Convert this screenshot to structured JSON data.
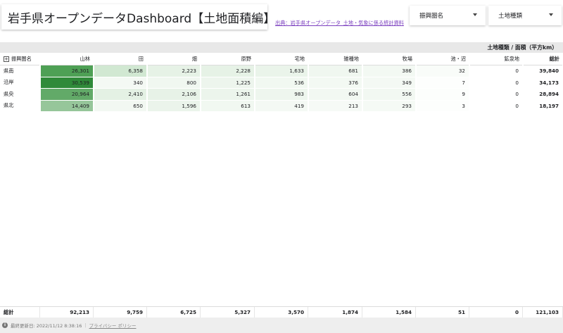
{
  "header": {
    "title": "岩手県オープンデータDashboard【土地面積編】",
    "source_link": "出典：岩手県オープンデータ_土地・気象に係る統計資料",
    "filters": [
      {
        "label": "振興圏名"
      },
      {
        "label": "土地種類"
      }
    ]
  },
  "table": {
    "pivot_header": "土地種類 / 面積（平方km）",
    "row_header": "振興圏名",
    "columns": [
      "山林",
      "田",
      "畑",
      "原野",
      "宅地",
      "雑種地",
      "牧場",
      "池・沼",
      "鉱泉地"
    ],
    "total_label": "総計",
    "rows": [
      {
        "name": "県南",
        "values": [
          "26,301",
          "6,358",
          "2,223",
          "2,228",
          "1,633",
          "681",
          "386",
          "32",
          "0"
        ],
        "total": "39,840"
      },
      {
        "name": "沿岸",
        "values": [
          "30,539",
          "340",
          "800",
          "1,225",
          "536",
          "376",
          "349",
          "7",
          "0"
        ],
        "total": "34,173"
      },
      {
        "name": "県央",
        "values": [
          "20,964",
          "2,410",
          "2,106",
          "1,261",
          "983",
          "604",
          "556",
          "9",
          "0"
        ],
        "total": "28,894"
      },
      {
        "name": "県北",
        "values": [
          "14,409",
          "650",
          "1,596",
          "613",
          "419",
          "213",
          "293",
          "3",
          "0"
        ],
        "total": "18,197"
      }
    ],
    "totals": {
      "label": "総計",
      "values": [
        "92,213",
        "9,759",
        "6,725",
        "5,327",
        "3,570",
        "1,874",
        "1,584",
        "51",
        "0"
      ],
      "grand_total": "121,103"
    },
    "heat_colors": {
      "row0": [
        "#4ea055",
        "#d1e8d2",
        "#e6f2e6",
        "#e6f2e6",
        "#eaf4ea",
        "#f0f7f0",
        "#f3f9f3",
        "#f9fcf9",
        "#ffffff"
      ],
      "row1": [
        "#2f8a39",
        "#f4f9f4",
        "#f0f7f0",
        "#edf5ed",
        "#f1f8f1",
        "#f3f9f3",
        "#f4f9f4",
        "#fdfefd",
        "#ffffff"
      ],
      "row2": [
        "#62aa68",
        "#e4f1e4",
        "#e7f2e7",
        "#ecf5ec",
        "#eef6ee",
        "#f2f8f2",
        "#f2f8f2",
        "#fcfefc",
        "#ffffff"
      ],
      "row3": [
        "#96c69a",
        "#f2f8f2",
        "#ebf4eb",
        "#f1f8f1",
        "#f4f9f4",
        "#f6faf6",
        "#f5faf5",
        "#fdfefd",
        "#ffffff"
      ]
    }
  },
  "footer": {
    "last_updated": "最終更新日: 2022/11/12 8:38:16",
    "privacy_policy": "プライバシー ポリシー"
  },
  "icons": {
    "expand": "plus-square-icon",
    "info": "info-icon",
    "dropdown": "caret-down-icon"
  }
}
